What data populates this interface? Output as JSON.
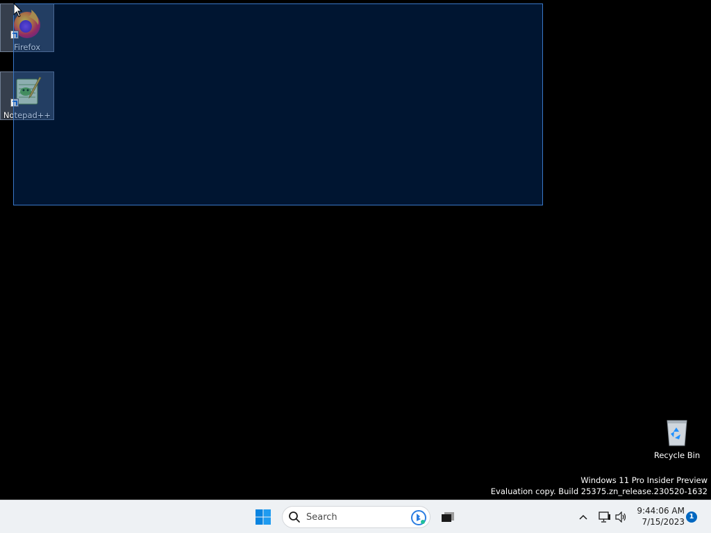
{
  "desktop": {
    "icons": [
      {
        "label": "Firefox",
        "icon": "firefox-icon"
      },
      {
        "label": "Notepad++",
        "icon": "notepadplusplus-icon"
      },
      {
        "label": "Recycle Bin",
        "icon": "recycle-bin-icon"
      }
    ],
    "watermark": {
      "line1": "Windows 11 Pro Insider Preview",
      "line2": "Evaluation copy. Build 25375.zn_release.230520-1632"
    }
  },
  "taskbar": {
    "search": {
      "placeholder": "Search"
    },
    "tray": {
      "time": "9:44:06 AM",
      "date": "7/15/2023",
      "notification_count": "1"
    }
  },
  "colors": {
    "desktop_background": "#000000",
    "selection_fill": "#002a5c",
    "selection_border": "#3a78c8",
    "taskbar_background": "#eef1f4",
    "accent": "#0067c0"
  }
}
